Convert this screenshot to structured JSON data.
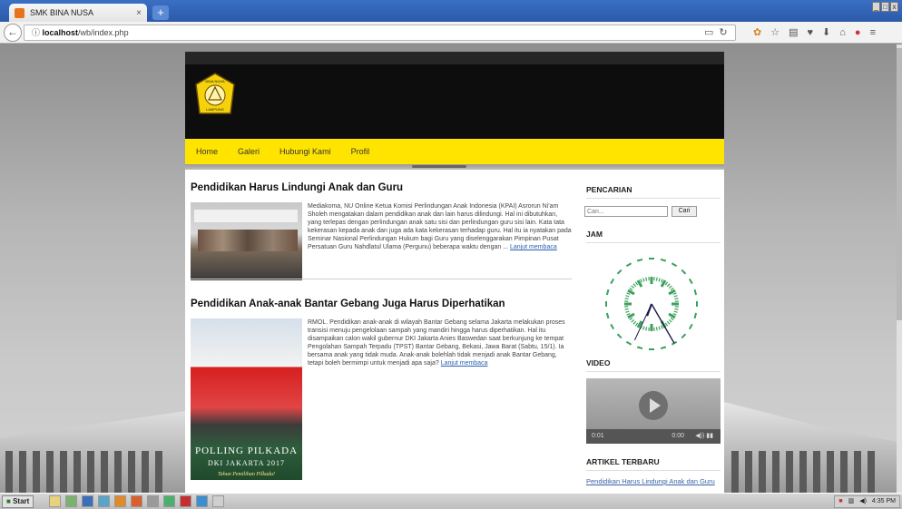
{
  "browser": {
    "tab_title": "SMK BINA NUSA",
    "url_prefix": "",
    "url_host": "localhost",
    "url_path": "/wb/index.php",
    "new_tab": "+",
    "tab_close": "×"
  },
  "site": {
    "logo_top_text": "BINA NUSA",
    "logo_bottom_text": "LAMPUNG",
    "nav": [
      "Home",
      "Galeri",
      "Hubungi Kami",
      "Profil"
    ]
  },
  "posts": [
    {
      "title": "Pendidikan Harus Lindungi Anak dan Guru",
      "excerpt": "Mediakoma, NU Online Ketua Komisi Perlindungan Anak Indonesia (KPAI) Asrorun Ni'am Sholeh mengatakan dalam pendidikan anak dan lain harus dilindungi. Hal ini dibutuhkan, yang terlepas dengan perlindungan anak satu sisi dan perlindungan guru sisi lain. Kata tata kekerasan kepada anak dan juga ada kata kekerasan terhadap guru. Hal itu ia nyatakan pada Seminar Nasional Perlindungan Hukum bagi Guru yang diselenggarakan Pimpinan Pusat Persatuan Guru Nahdlatul Ulama (Pergunu) beberapa waktu dengan ...",
      "read_more": "Lanjut membaca"
    },
    {
      "title": "Pendidikan Anak-anak Bantar Gebang Juga Harus Diperhatikan",
      "excerpt": "RMOL. Pendidikan anak-anak di wilayah Bantar Gebang selama Jakarta melakukan proses transisi menuju pengelolaan sampah yang mandiri hingga harus diperhatikan. Hal itu disampaikan calon wakil gubernur DKI Jakarta Anies Baswedan saat berkunjung ke tempat Pengolahan Sampah Terpadu (TPST) Bantar Gebang, Bekasi, Jawa Barat (Sabtu, 15/1). Ia bersama anak yang tidak muda. Anak-anak bolehlah tidak menjadi anak Bantar Gebang, tetapi boleh bermimpi untuk menjadi apa saja?",
      "read_more": "Lanjut membaca",
      "image_line1": "POLLING PILKADA",
      "image_line2": "DKI JAKARTA 2017",
      "image_line3": "Tahun Pemilihan Pilkada!"
    }
  ],
  "sidebar": {
    "search_title": "PENCARIAN",
    "search_placeholder": "Cari...",
    "search_button": "Cari",
    "clock_title": "JAM",
    "video_title": "VIDEO",
    "video_time": "0:00",
    "video_counter": "0:01",
    "articles_title": "ARTIKEL TERBARU",
    "article_link": "Pendidikan Harus Lindungi Anak dan Guru"
  },
  "taskbar": {
    "start": "Start",
    "clock": "4:35 PM"
  }
}
